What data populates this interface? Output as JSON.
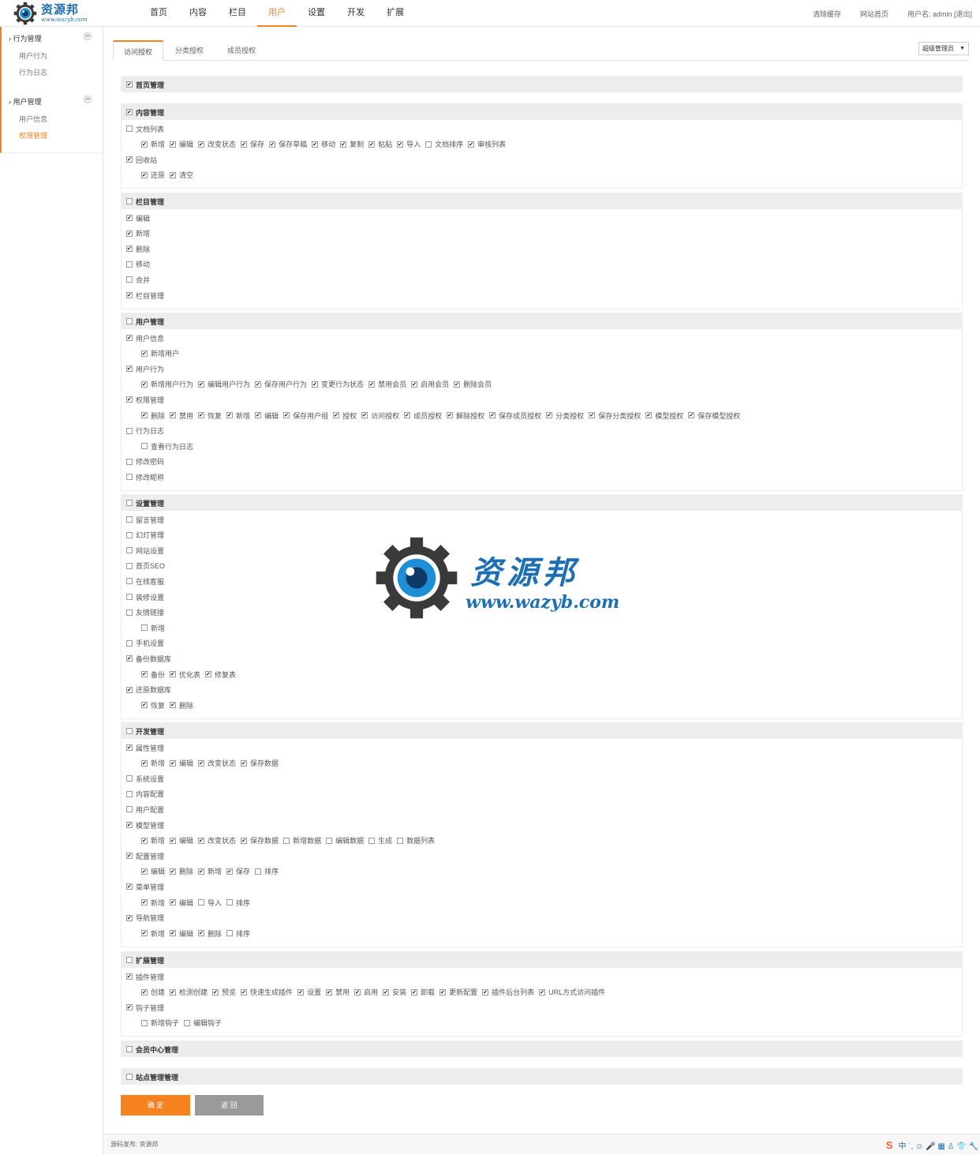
{
  "logo": {
    "name": "资源邦",
    "url": "www.wazyb.com"
  },
  "nav": [
    "首页",
    "内容",
    "栏目",
    "用户",
    "设置",
    "开发",
    "扩展"
  ],
  "nav_active": "用户",
  "toplinks": {
    "clear_cache": "清除缓存",
    "site_home": "网站首页",
    "user": "用户名: admin [退出]"
  },
  "sidebar": {
    "groups": [
      {
        "label": "行为管理",
        "items": [
          "用户行为",
          "行为日志"
        ]
      },
      {
        "label": "用户管理",
        "items": [
          "用户信息",
          "权限管理"
        ]
      }
    ],
    "active_item": "权限管理",
    "collapse_symbol": "−"
  },
  "tabs": [
    "访问授权",
    "分类授权",
    "成员授权"
  ],
  "role_select": "超级管理员",
  "sections": [
    {
      "title": "首页管理",
      "checked": true,
      "rows": []
    },
    {
      "title": "内容管理",
      "checked": true,
      "rows": [
        {
          "label": "文档列表",
          "checked": false,
          "subs": [
            [
              "新增",
              1
            ],
            [
              "编辑",
              1
            ],
            [
              "改变状态",
              1
            ],
            [
              "保存",
              1
            ],
            [
              "保存草稿",
              1
            ],
            [
              "移动",
              1
            ],
            [
              "复制",
              1
            ],
            [
              "粘贴",
              1
            ],
            [
              "导入",
              1
            ],
            [
              "文档排序",
              0
            ],
            [
              "审核列表",
              1
            ]
          ]
        },
        {
          "label": "回收站",
          "checked": true,
          "subs": [
            [
              "还原",
              1
            ],
            [
              "清空",
              1
            ]
          ]
        }
      ]
    },
    {
      "title": "栏目管理",
      "checked": false,
      "rows": [
        {
          "label": "编辑",
          "checked": true
        },
        {
          "label": "新增",
          "checked": true
        },
        {
          "label": "删除",
          "checked": true
        },
        {
          "label": "移动",
          "checked": false
        },
        {
          "label": "合并",
          "checked": false
        },
        {
          "label": "栏目管理",
          "checked": true
        }
      ]
    },
    {
      "title": "用户管理",
      "checked": false,
      "rows": [
        {
          "label": "用户信息",
          "checked": true,
          "subs": [
            [
              "新增用户",
              1
            ]
          ]
        },
        {
          "label": "用户行为",
          "checked": true,
          "subs": [
            [
              "新增用户行为",
              1
            ],
            [
              "编辑用户行为",
              1
            ],
            [
              "保存用户行为",
              1
            ],
            [
              "变更行为状态",
              1
            ],
            [
              "禁用会员",
              1
            ],
            [
              "启用会员",
              1
            ],
            [
              "删除会员",
              1
            ]
          ]
        },
        {
          "label": "权限管理",
          "checked": true,
          "subs": [
            [
              "删除",
              1
            ],
            [
              "禁用",
              1
            ],
            [
              "恢复",
              1
            ],
            [
              "新增",
              1
            ],
            [
              "编辑",
              1
            ],
            [
              "保存用户组",
              1
            ],
            [
              "授权",
              1
            ],
            [
              "访问授权",
              1
            ],
            [
              "成员授权",
              1
            ],
            [
              "解除授权",
              1
            ],
            [
              "保存成员授权",
              1
            ],
            [
              "分类授权",
              1
            ],
            [
              "保存分类授权",
              1
            ],
            [
              "模型授权",
              1
            ],
            [
              "保存模型授权",
              1
            ]
          ]
        },
        {
          "label": "行为日志",
          "checked": false,
          "subs": [
            [
              "查看行为日志",
              0
            ]
          ]
        },
        {
          "label": "修改密码",
          "checked": false
        },
        {
          "label": "修改昵称",
          "checked": false
        }
      ]
    },
    {
      "title": "设置管理",
      "checked": false,
      "rows": [
        {
          "label": "留言管理",
          "checked": false
        },
        {
          "label": "幻灯管理",
          "checked": false
        },
        {
          "label": "网站设置",
          "checked": false
        },
        {
          "label": "首页SEO",
          "checked": false
        },
        {
          "label": "在线客服",
          "checked": false
        },
        {
          "label": "装修设置",
          "checked": false
        },
        {
          "label": "友情链接",
          "checked": false,
          "subs": [
            [
              "新增",
              0
            ]
          ]
        },
        {
          "label": "手机设置",
          "checked": false
        },
        {
          "label": "备份数据库",
          "checked": true,
          "subs": [
            [
              "备份",
              1
            ],
            [
              "优化表",
              1
            ],
            [
              "修复表",
              1
            ]
          ]
        },
        {
          "label": "还原数据库",
          "checked": true,
          "subs": [
            [
              "恢复",
              1
            ],
            [
              "删除",
              1
            ]
          ]
        }
      ]
    },
    {
      "title": "开发管理",
      "checked": false,
      "rows": [
        {
          "label": "属性管理",
          "checked": true,
          "subs": [
            [
              "新增",
              1
            ],
            [
              "编辑",
              1
            ],
            [
              "改变状态",
              1
            ],
            [
              "保存数据",
              1
            ]
          ]
        },
        {
          "label": "系统设置",
          "checked": false
        },
        {
          "label": "内容配置",
          "checked": false
        },
        {
          "label": "用户配置",
          "checked": false
        },
        {
          "label": "模型管理",
          "checked": true,
          "subs": [
            [
              "新增",
              1
            ],
            [
              "编辑",
              1
            ],
            [
              "改变状态",
              1
            ],
            [
              "保存数据",
              1
            ],
            [
              "新增数据",
              0
            ],
            [
              "编辑数据",
              0
            ],
            [
              "生成",
              0
            ],
            [
              "数据列表",
              0
            ]
          ]
        },
        {
          "label": "配置管理",
          "checked": true,
          "subs": [
            [
              "编辑",
              1
            ],
            [
              "删除",
              1
            ],
            [
              "新增",
              1
            ],
            [
              "保存",
              1
            ],
            [
              "排序",
              0
            ]
          ]
        },
        {
          "label": "菜单管理",
          "checked": true,
          "subs": [
            [
              "新增",
              1
            ],
            [
              "编辑",
              1
            ],
            [
              "导入",
              0
            ],
            [
              "排序",
              0
            ]
          ]
        },
        {
          "label": "导航管理",
          "checked": true,
          "subs": [
            [
              "新增",
              1
            ],
            [
              "编辑",
              1
            ],
            [
              "删除",
              1
            ],
            [
              "排序",
              0
            ]
          ]
        }
      ]
    },
    {
      "title": "扩展管理",
      "checked": false,
      "rows": [
        {
          "label": "插件管理",
          "checked": true,
          "subs": [
            [
              "创建",
              1
            ],
            [
              "检测创建",
              1
            ],
            [
              "预览",
              1
            ],
            [
              "快速生成插件",
              1
            ],
            [
              "设置",
              1
            ],
            [
              "禁用",
              1
            ],
            [
              "启用",
              1
            ],
            [
              "安装",
              1
            ],
            [
              "卸载",
              1
            ],
            [
              "更新配置",
              1
            ],
            [
              "插件后台列表",
              1
            ],
            [
              "URL方式访问插件",
              1
            ]
          ]
        },
        {
          "label": "钩子管理",
          "checked": true,
          "subs": [
            [
              "新增钩子",
              0
            ],
            [
              "编辑钩子",
              0
            ]
          ]
        }
      ]
    },
    {
      "title": "会员中心管理",
      "checked": false,
      "rows": []
    },
    {
      "title": "站点管理管理",
      "checked": false,
      "rows": []
    }
  ],
  "buttons": {
    "ok": "确 定",
    "back": "返 回"
  },
  "footer": "源码发布: 资源邦",
  "watermark": {
    "cn": "资源邦",
    "url": "www.wazyb.com"
  },
  "ime": {
    "logo": "S",
    "text": "中 ˙, ☺ 🎤 ▦ ♙ 👕 🔧"
  }
}
